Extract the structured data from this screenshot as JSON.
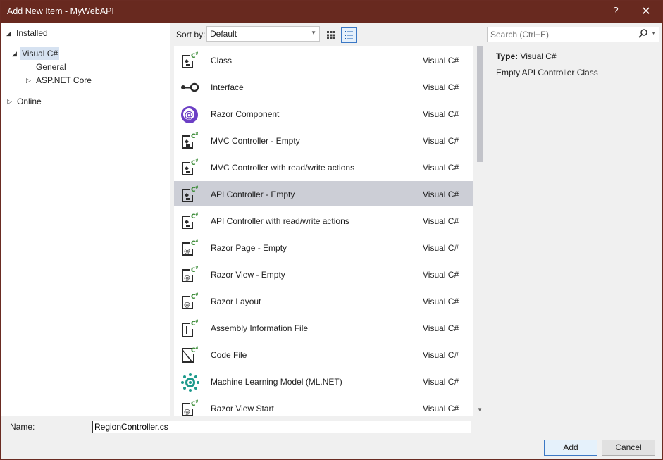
{
  "window": {
    "title": "Add New Item - MyWebAPI",
    "help_glyph": "?",
    "close_glyph": "✕"
  },
  "tree": {
    "installed": "Installed",
    "visual_csharp": "Visual C#",
    "general": "General",
    "aspnet_core": "ASP.NET Core",
    "online": "Online"
  },
  "sortbar": {
    "label": "Sort by:",
    "value": "Default"
  },
  "search": {
    "placeholder": "Search (Ctrl+E)"
  },
  "templates": [
    {
      "name": "Class",
      "lang": "Visual C#",
      "icon": "cs-class-icon"
    },
    {
      "name": "Interface",
      "lang": "Visual C#",
      "icon": "interface-icon"
    },
    {
      "name": "Razor Component",
      "lang": "Visual C#",
      "icon": "razor-component-icon"
    },
    {
      "name": "MVC Controller - Empty",
      "lang": "Visual C#",
      "icon": "cs-class-icon"
    },
    {
      "name": "MVC Controller with read/write actions",
      "lang": "Visual C#",
      "icon": "cs-class-icon"
    },
    {
      "name": "API Controller - Empty",
      "lang": "Visual C#",
      "icon": "cs-class-icon",
      "selected": true
    },
    {
      "name": "API Controller with read/write actions",
      "lang": "Visual C#",
      "icon": "cs-class-icon"
    },
    {
      "name": "Razor Page - Empty",
      "lang": "Visual C#",
      "icon": "razor-page-icon"
    },
    {
      "name": "Razor View - Empty",
      "lang": "Visual C#",
      "icon": "razor-page-icon"
    },
    {
      "name": "Razor Layout",
      "lang": "Visual C#",
      "icon": "razor-page-icon"
    },
    {
      "name": "Assembly Information File",
      "lang": "Visual C#",
      "icon": "info-file-icon"
    },
    {
      "name": "Code File",
      "lang": "Visual C#",
      "icon": "code-file-icon"
    },
    {
      "name": "Machine Learning Model (ML.NET)",
      "lang": "Visual C#",
      "icon": "ml-model-icon"
    },
    {
      "name": "Razor View Start",
      "lang": "Visual C#",
      "icon": "razor-page-icon"
    }
  ],
  "details": {
    "type_label": "Type:",
    "type_value": "Visual C#",
    "description": "Empty API Controller Class"
  },
  "bottom": {
    "name_label": "Name:",
    "name_value": "RegionController.cs",
    "add_label": "Add",
    "cancel_label": "Cancel"
  },
  "colors": {
    "titlebar": "#68291f",
    "selection": "#ccced6",
    "accent": "#3b78c5",
    "csharp_green": "#388a34",
    "razor_purple": "#6c3fc5",
    "ml_teal": "#1d9a8c"
  }
}
